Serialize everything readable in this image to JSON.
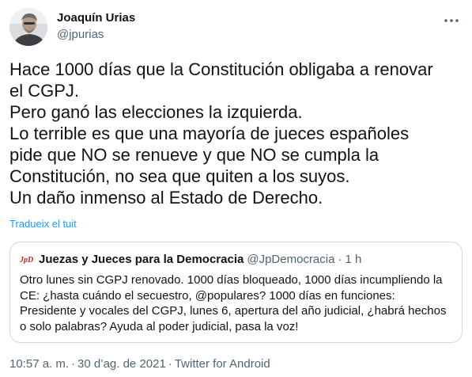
{
  "author": {
    "name": "Joaquín Urias",
    "handle": "@jpurias"
  },
  "tweet": {
    "lines": [
      "Hace 1000 días que la Constitución obligaba a renovar",
      "el CGPJ.",
      "Pero ganó las elecciones la izquierda.",
      "Lo terrible es que una mayoría de jueces españoles",
      "pide que NO se renueve y que NO se cumpla la",
      "Constitución, no sea que quiten a los suyos.",
      "Un daño inmenso al Estado de Derecho."
    ],
    "translate_label": "Tradueix el tuit"
  },
  "quote": {
    "logo_text": "JpD",
    "name": "Juezas y Jueces para la Democracia",
    "handle": "@JpDemocracia",
    "dot": "·",
    "time": "1 h",
    "lines": [
      "Otro lunes sin CGPJ renovado. 1000 días bloqueado, 1000 días incumpliendo la",
      "CE: ¿hasta cuándo el secuestro, @populares? 1000 días en funciones:",
      "Presidente y vocales del CGPJ, lunes 6, apertura del año judicial, ¿habrá hechos",
      "o solo palabras? Ayuda al poder judicial, pasa la voz!"
    ]
  },
  "meta": {
    "time": "10:57 a. m.",
    "sep": "·",
    "date": "30 d’ag. de 2021",
    "source": "Twitter for Android"
  },
  "icons": {
    "more": "more-horizontal-icon",
    "avatar": "avatar",
    "quote_logo": "jpd-logo"
  },
  "colors": {
    "text": "#0f1419",
    "secondary": "#536471",
    "link": "#1d9bf0",
    "border": "#cfd9de",
    "logo_red": "#c0272d"
  }
}
